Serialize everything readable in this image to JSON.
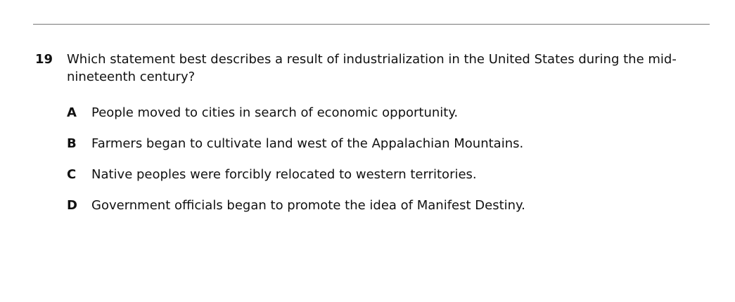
{
  "question": {
    "number": "19",
    "text": "Which statement best describes a result of industrialization in the United States during the mid-nineteenth century?"
  },
  "choices": [
    {
      "letter": "A",
      "text": "People moved to cities in search of economic opportunity."
    },
    {
      "letter": "B",
      "text": "Farmers began to cultivate land west of the Appalachian Mountains."
    },
    {
      "letter": "C",
      "text": "Native peoples were forcibly relocated to western territories."
    },
    {
      "letter": "D",
      "text": "Government officials began to promote the idea of Manifest Destiny."
    }
  ]
}
